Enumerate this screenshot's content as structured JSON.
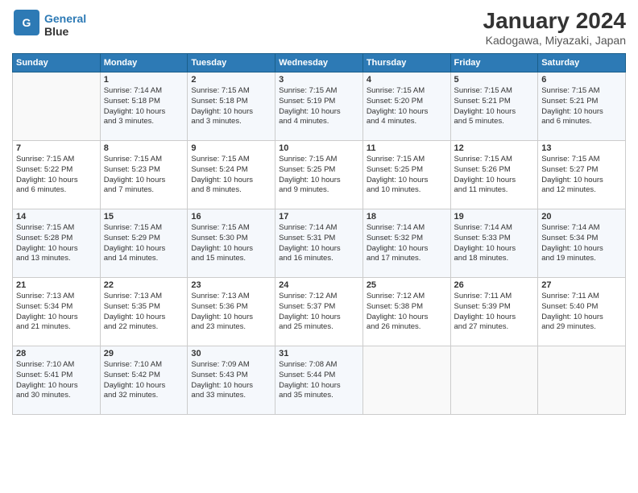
{
  "header": {
    "logo_line1": "General",
    "logo_line2": "Blue",
    "month": "January 2024",
    "location": "Kadogawa, Miyazaki, Japan"
  },
  "days_of_week": [
    "Sunday",
    "Monday",
    "Tuesday",
    "Wednesday",
    "Thursday",
    "Friday",
    "Saturday"
  ],
  "weeks": [
    [
      {
        "day": "",
        "info": ""
      },
      {
        "day": "1",
        "info": "Sunrise: 7:14 AM\nSunset: 5:18 PM\nDaylight: 10 hours\nand 3 minutes."
      },
      {
        "day": "2",
        "info": "Sunrise: 7:15 AM\nSunset: 5:18 PM\nDaylight: 10 hours\nand 3 minutes."
      },
      {
        "day": "3",
        "info": "Sunrise: 7:15 AM\nSunset: 5:19 PM\nDaylight: 10 hours\nand 4 minutes."
      },
      {
        "day": "4",
        "info": "Sunrise: 7:15 AM\nSunset: 5:20 PM\nDaylight: 10 hours\nand 4 minutes."
      },
      {
        "day": "5",
        "info": "Sunrise: 7:15 AM\nSunset: 5:21 PM\nDaylight: 10 hours\nand 5 minutes."
      },
      {
        "day": "6",
        "info": "Sunrise: 7:15 AM\nSunset: 5:21 PM\nDaylight: 10 hours\nand 6 minutes."
      }
    ],
    [
      {
        "day": "7",
        "info": "Sunrise: 7:15 AM\nSunset: 5:22 PM\nDaylight: 10 hours\nand 6 minutes."
      },
      {
        "day": "8",
        "info": "Sunrise: 7:15 AM\nSunset: 5:23 PM\nDaylight: 10 hours\nand 7 minutes."
      },
      {
        "day": "9",
        "info": "Sunrise: 7:15 AM\nSunset: 5:24 PM\nDaylight: 10 hours\nand 8 minutes."
      },
      {
        "day": "10",
        "info": "Sunrise: 7:15 AM\nSunset: 5:25 PM\nDaylight: 10 hours\nand 9 minutes."
      },
      {
        "day": "11",
        "info": "Sunrise: 7:15 AM\nSunset: 5:25 PM\nDaylight: 10 hours\nand 10 minutes."
      },
      {
        "day": "12",
        "info": "Sunrise: 7:15 AM\nSunset: 5:26 PM\nDaylight: 10 hours\nand 11 minutes."
      },
      {
        "day": "13",
        "info": "Sunrise: 7:15 AM\nSunset: 5:27 PM\nDaylight: 10 hours\nand 12 minutes."
      }
    ],
    [
      {
        "day": "14",
        "info": "Sunrise: 7:15 AM\nSunset: 5:28 PM\nDaylight: 10 hours\nand 13 minutes."
      },
      {
        "day": "15",
        "info": "Sunrise: 7:15 AM\nSunset: 5:29 PM\nDaylight: 10 hours\nand 14 minutes."
      },
      {
        "day": "16",
        "info": "Sunrise: 7:15 AM\nSunset: 5:30 PM\nDaylight: 10 hours\nand 15 minutes."
      },
      {
        "day": "17",
        "info": "Sunrise: 7:14 AM\nSunset: 5:31 PM\nDaylight: 10 hours\nand 16 minutes."
      },
      {
        "day": "18",
        "info": "Sunrise: 7:14 AM\nSunset: 5:32 PM\nDaylight: 10 hours\nand 17 minutes."
      },
      {
        "day": "19",
        "info": "Sunrise: 7:14 AM\nSunset: 5:33 PM\nDaylight: 10 hours\nand 18 minutes."
      },
      {
        "day": "20",
        "info": "Sunrise: 7:14 AM\nSunset: 5:34 PM\nDaylight: 10 hours\nand 19 minutes."
      }
    ],
    [
      {
        "day": "21",
        "info": "Sunrise: 7:13 AM\nSunset: 5:34 PM\nDaylight: 10 hours\nand 21 minutes."
      },
      {
        "day": "22",
        "info": "Sunrise: 7:13 AM\nSunset: 5:35 PM\nDaylight: 10 hours\nand 22 minutes."
      },
      {
        "day": "23",
        "info": "Sunrise: 7:13 AM\nSunset: 5:36 PM\nDaylight: 10 hours\nand 23 minutes."
      },
      {
        "day": "24",
        "info": "Sunrise: 7:12 AM\nSunset: 5:37 PM\nDaylight: 10 hours\nand 25 minutes."
      },
      {
        "day": "25",
        "info": "Sunrise: 7:12 AM\nSunset: 5:38 PM\nDaylight: 10 hours\nand 26 minutes."
      },
      {
        "day": "26",
        "info": "Sunrise: 7:11 AM\nSunset: 5:39 PM\nDaylight: 10 hours\nand 27 minutes."
      },
      {
        "day": "27",
        "info": "Sunrise: 7:11 AM\nSunset: 5:40 PM\nDaylight: 10 hours\nand 29 minutes."
      }
    ],
    [
      {
        "day": "28",
        "info": "Sunrise: 7:10 AM\nSunset: 5:41 PM\nDaylight: 10 hours\nand 30 minutes."
      },
      {
        "day": "29",
        "info": "Sunrise: 7:10 AM\nSunset: 5:42 PM\nDaylight: 10 hours\nand 32 minutes."
      },
      {
        "day": "30",
        "info": "Sunrise: 7:09 AM\nSunset: 5:43 PM\nDaylight: 10 hours\nand 33 minutes."
      },
      {
        "day": "31",
        "info": "Sunrise: 7:08 AM\nSunset: 5:44 PM\nDaylight: 10 hours\nand 35 minutes."
      },
      {
        "day": "",
        "info": ""
      },
      {
        "day": "",
        "info": ""
      },
      {
        "day": "",
        "info": ""
      }
    ]
  ]
}
